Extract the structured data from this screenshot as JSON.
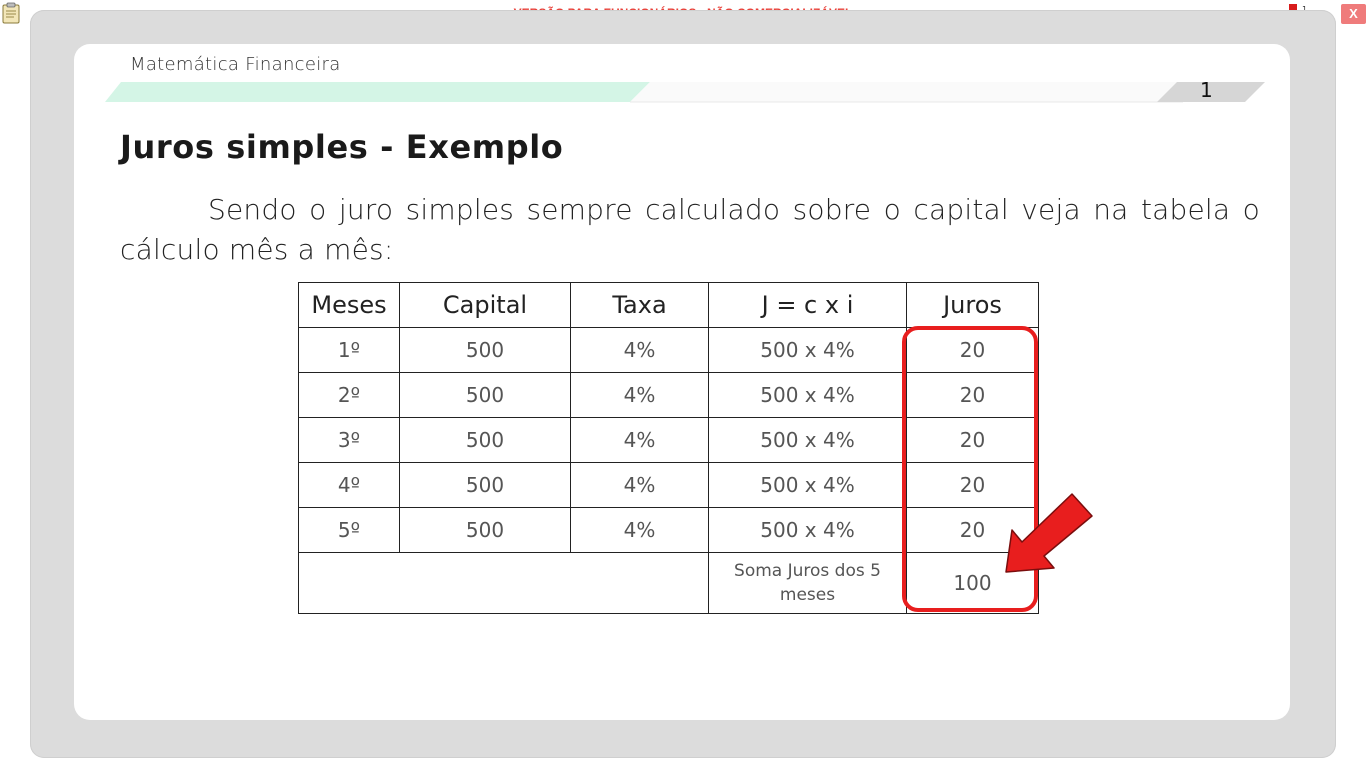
{
  "watermark": "VERSÃO PARA FUNCIONÁRIOS - NÃO COMERCIALIZÁVEL",
  "window": {
    "close_label": "X"
  },
  "header": {
    "course_title": "Matemática Financeira",
    "page_number": "1"
  },
  "slide": {
    "title": "Juros simples - Exemplo",
    "paragraph": "Sendo o juro simples sempre calculado sobre o capital veja na tabela o cálculo mês a mês:"
  },
  "table": {
    "headers": [
      "Meses",
      "Capital",
      "Taxa",
      "J = c x i",
      "Juros"
    ],
    "rows": [
      [
        "1º",
        "500",
        "4%",
        "500 x 4%",
        "20"
      ],
      [
        "2º",
        "500",
        "4%",
        "500 x 4%",
        "20"
      ],
      [
        "3º",
        "500",
        "4%",
        "500 x 4%",
        "20"
      ],
      [
        "4º",
        "500",
        "4%",
        "500 x 4%",
        "20"
      ],
      [
        "5º",
        "500",
        "4%",
        "500 x 4%",
        "20"
      ]
    ],
    "total_label": "Soma Juros dos 5 meses",
    "total_value": "100"
  },
  "colors": {
    "highlight": "#e81e1e",
    "watermark": "#e8413a",
    "header_band": "#d4f5e6"
  },
  "icons": {
    "clipboard": "clipboard-icon",
    "network": "network-tree-icon",
    "arrow": "red-arrow-icon"
  }
}
